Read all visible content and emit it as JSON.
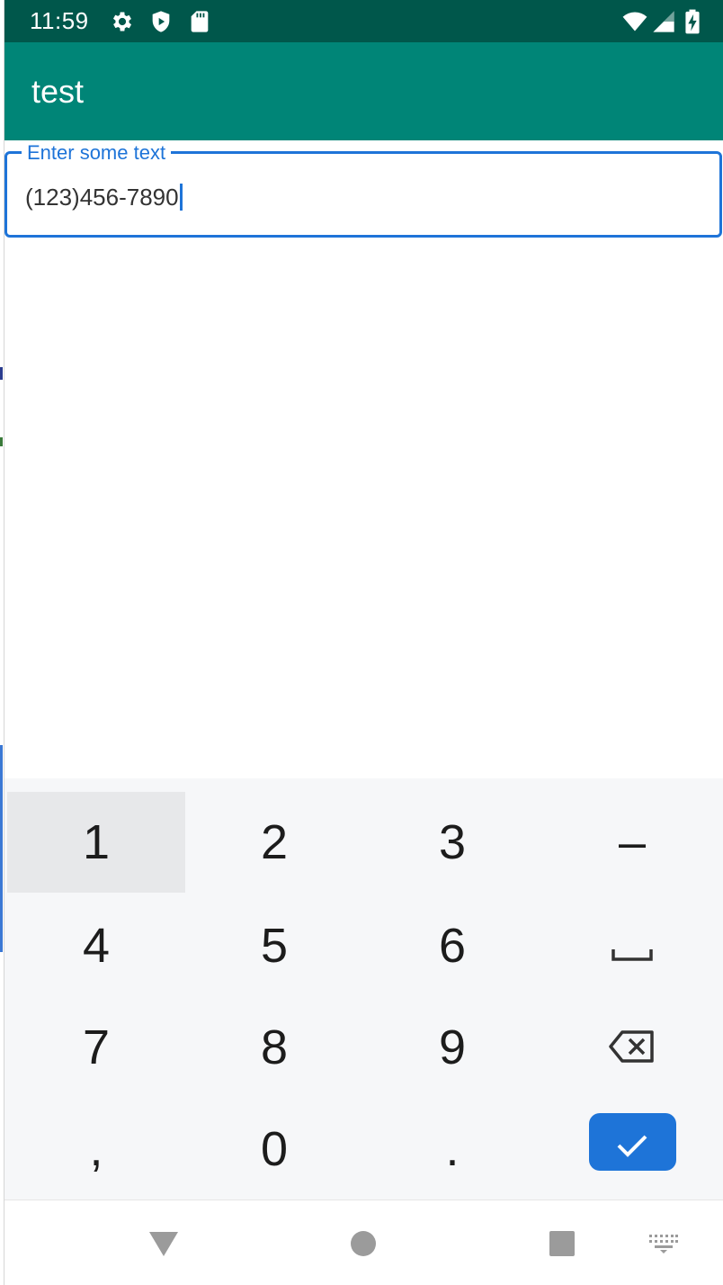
{
  "status_bar": {
    "time": "11:59",
    "icons": [
      "gear-icon",
      "shield-icon",
      "sd-card-icon",
      "wifi-icon",
      "signal-icon",
      "battery-charging-icon"
    ]
  },
  "app_bar": {
    "title": "test"
  },
  "text_field": {
    "label": "Enter some text",
    "value": "(123)456-7890"
  },
  "keyboard": {
    "keys": [
      [
        "1",
        "2",
        "3",
        "–"
      ],
      [
        "4",
        "5",
        "6",
        "space"
      ],
      [
        "7",
        "8",
        "9",
        "backspace"
      ],
      [
        ",",
        "0",
        ".",
        "done"
      ]
    ],
    "accent": "#1e74d8"
  },
  "nav_bar": {
    "icons": [
      "back-icon",
      "home-icon",
      "recents-icon",
      "keyboard-switch-icon"
    ]
  },
  "colors": {
    "status_bar": "#00574b",
    "app_bar": "#008577",
    "focus": "#1e74d8"
  }
}
